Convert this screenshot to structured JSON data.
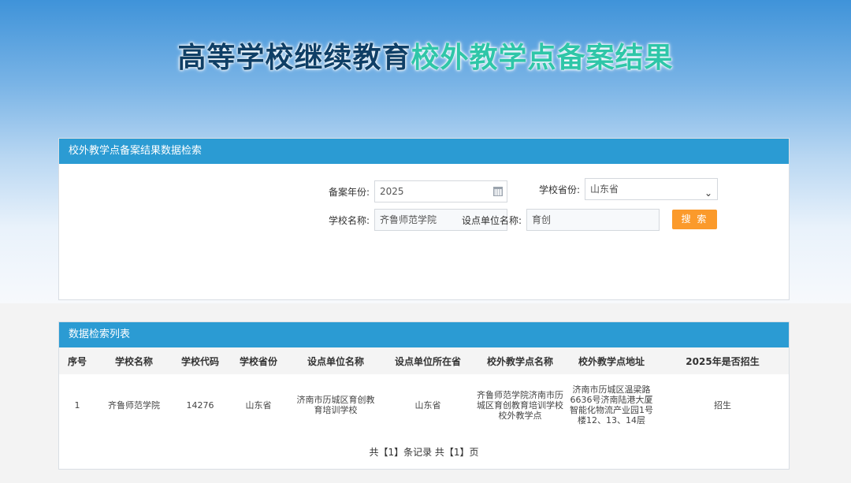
{
  "title": {
    "part1": "高等学校继续教育",
    "part2": "校外教学点备案结果"
  },
  "search": {
    "heading": "校外教学点备案结果数据检索",
    "year_label": "备案年份:",
    "year_value": "2025",
    "province_label": "学校省份:",
    "province_value": "山东省",
    "school_label": "学校名称:",
    "school_value": "齐鲁师范学院",
    "unit_label": "设点单位名称:",
    "unit_value": "育创",
    "search_button": "搜 索"
  },
  "list": {
    "heading": "数据检索列表",
    "columns": [
      "序号",
      "学校名称",
      "学校代码",
      "学校省份",
      "设点单位名称",
      "设点单位所在省",
      "校外教学点名称",
      "校外教学点地址",
      "2025年是否招生"
    ],
    "rows": [
      [
        "1",
        "齐鲁师范学院",
        "14276",
        "山东省",
        "济南市历城区育创教育培训学校",
        "山东省",
        "齐鲁师范学院济南市历城区育创教育培训学校校外教学点",
        "济南市历城区温梁路6636号济南陆港大厦智能化物流产业园1号楼12、13、14层",
        "招生"
      ]
    ],
    "pager": "共【1】条记录 共【1】页"
  },
  "icons": {
    "date": "calendar-icon",
    "select": "chevron-down-icon"
  },
  "colors": {
    "header_blue": "#2b9bd3",
    "button_orange": "#fb9a2b",
    "title_dark": "#0f3f66",
    "title_green": "#2fc6a8"
  }
}
